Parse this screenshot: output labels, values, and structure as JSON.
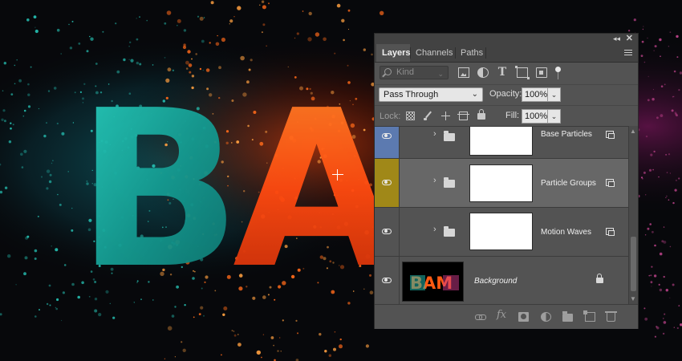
{
  "artwork": {
    "letters": [
      "B",
      "A"
    ],
    "colors": {
      "teal": "#1fb5a8",
      "orange": "#ff5a12",
      "background": "#07080b"
    }
  },
  "panel": {
    "tabs": [
      {
        "label": "Layers",
        "active": true
      },
      {
        "label": "Channels",
        "active": false
      },
      {
        "label": "Paths",
        "active": false
      }
    ],
    "filter": {
      "kind_placeholder": "Kind",
      "icons": [
        "image-filter-icon",
        "adjustment-filter-icon",
        "type-filter-icon",
        "shape-filter-icon",
        "smart-object-filter-icon",
        "filter-toggle-icon"
      ]
    },
    "blend_mode": "Pass Through",
    "opacity_label": "Opacity:",
    "opacity_value": "100%",
    "lock_label": "Lock:",
    "fill_label": "Fill:",
    "fill_value": "100%",
    "layers": [
      {
        "name": "Base Particles",
        "type": "group",
        "visible": true,
        "eye_color": "#5c7ab0"
      },
      {
        "name": "Particle Groups",
        "type": "group",
        "visible": true,
        "eye_color": "#a08818",
        "selected": true
      },
      {
        "name": "Motion Waves",
        "type": "group",
        "visible": true,
        "eye_color": "#535353"
      },
      {
        "name": "Background",
        "type": "background",
        "visible": true,
        "thumb_text": "BAM",
        "locked": true
      }
    ],
    "footer_icons": [
      "link-layers-icon",
      "fx-icon",
      "add-mask-icon",
      "new-adjustment-icon",
      "new-group-icon",
      "new-layer-icon",
      "delete-icon"
    ]
  }
}
